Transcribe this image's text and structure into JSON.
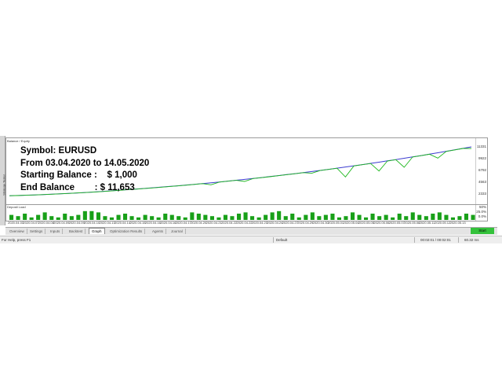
{
  "chart": {
    "legend": "Balance / Equity",
    "overlay": {
      "symbol": "Symbol: EURUSD",
      "period": "From 03.04.2020 to 14.05.2020",
      "starting_balance": "Starting Balance :    $ 1,000",
      "end_balance": "End Balance        : $ 11,653"
    },
    "y_ticks": [
      "11331",
      "9922",
      "6792",
      "4563",
      "2333"
    ],
    "colors": {
      "balance": "#3c3cd0",
      "equity": "#1eb81e",
      "load": "#19a019"
    }
  },
  "chart_data": {
    "type": "line",
    "series": [
      {
        "name": "Balance",
        "values": [
          1000,
          1050,
          1110,
          1170,
          1250,
          1330,
          1420,
          1510,
          1600,
          1700,
          1800,
          1920,
          2050,
          2180,
          2310,
          2440,
          2580,
          2720,
          2860,
          3010,
          3160,
          3320,
          3480,
          3650,
          3820,
          4000,
          4180,
          4370,
          4560,
          4760,
          4960,
          5170,
          5380,
          5600,
          5820,
          6050,
          6280,
          6520,
          6760,
          7010,
          7260,
          7520,
          7780,
          8050,
          8320,
          8600,
          8880,
          9170,
          9460,
          9760,
          10060,
          10370,
          10690,
          11010,
          11340,
          11653
        ]
      },
      {
        "name": "Equity",
        "values": [
          1000,
          1030,
          1090,
          1160,
          1230,
          1320,
          1400,
          1500,
          1590,
          1680,
          1790,
          1900,
          2030,
          2160,
          2290,
          2420,
          2560,
          2700,
          2840,
          2990,
          3140,
          3300,
          3460,
          3630,
          3380,
          3980,
          4160,
          4350,
          4120,
          4740,
          4940,
          5150,
          5360,
          5580,
          5800,
          6030,
          5900,
          6500,
          6740,
          6990,
          5100,
          7500,
          7760,
          8030,
          6400,
          8580,
          8860,
          7200,
          9440,
          9740,
          10040,
          9200,
          10670,
          10990,
          11320,
          11300
        ]
      }
    ],
    "load_values": [
      4,
      3,
      5,
      2,
      4,
      6,
      3,
      2,
      5,
      3,
      4,
      7,
      7,
      6,
      3,
      2,
      4,
      5,
      3,
      2,
      4,
      3,
      2,
      5,
      4,
      3,
      2,
      6,
      5,
      4,
      3,
      2,
      4,
      3,
      5,
      6,
      3,
      2,
      4,
      6,
      7,
      3,
      5,
      2,
      4,
      6,
      3,
      4,
      5,
      2,
      3,
      6,
      4,
      2,
      5,
      3,
      4,
      2,
      5,
      3,
      6,
      4,
      3,
      5,
      6,
      4,
      2,
      3,
      5,
      4
    ],
    "dates": [
      "2020.04.03",
      "2020.04.07",
      "2020.04.08",
      "2020.04.09",
      "2020.04.09",
      "2020.04.10",
      "2020.04.13",
      "2020.04.14",
      "2020.04.15",
      "2020.04.16",
      "2020.04.16",
      "2020.04.17",
      "2020.04.20",
      "2020.04.21",
      "2020.04.22",
      "2020.04.22",
      "2020.04.23",
      "2020.04.24",
      "2020.04.27",
      "2020.04.29",
      "2020.04.30",
      "2020.05.01",
      "2020.05.04",
      "2020.05.05",
      "2020.05.06",
      "2020.05.07",
      "2020.05.08",
      "2020.05.11",
      "2020.05.12",
      "2020.05.13"
    ],
    "ylim": [
      0,
      12000
    ]
  },
  "load": {
    "label": "Deposit Load",
    "ticks": [
      "50%",
      "25.0%",
      "0.0%"
    ]
  },
  "tabs": [
    "Overview",
    "Settings",
    "Inputs",
    "Backtest",
    "Graph",
    "Optimization Results",
    "Agents",
    "Journal"
  ],
  "active_tab": "Graph",
  "start_button": "Start",
  "status": {
    "help": "For Help, press F1",
    "profile": "Default",
    "time": "00:02:01 / 00:02:01",
    "ping": "60.32 ms"
  },
  "progress": 1.0
}
